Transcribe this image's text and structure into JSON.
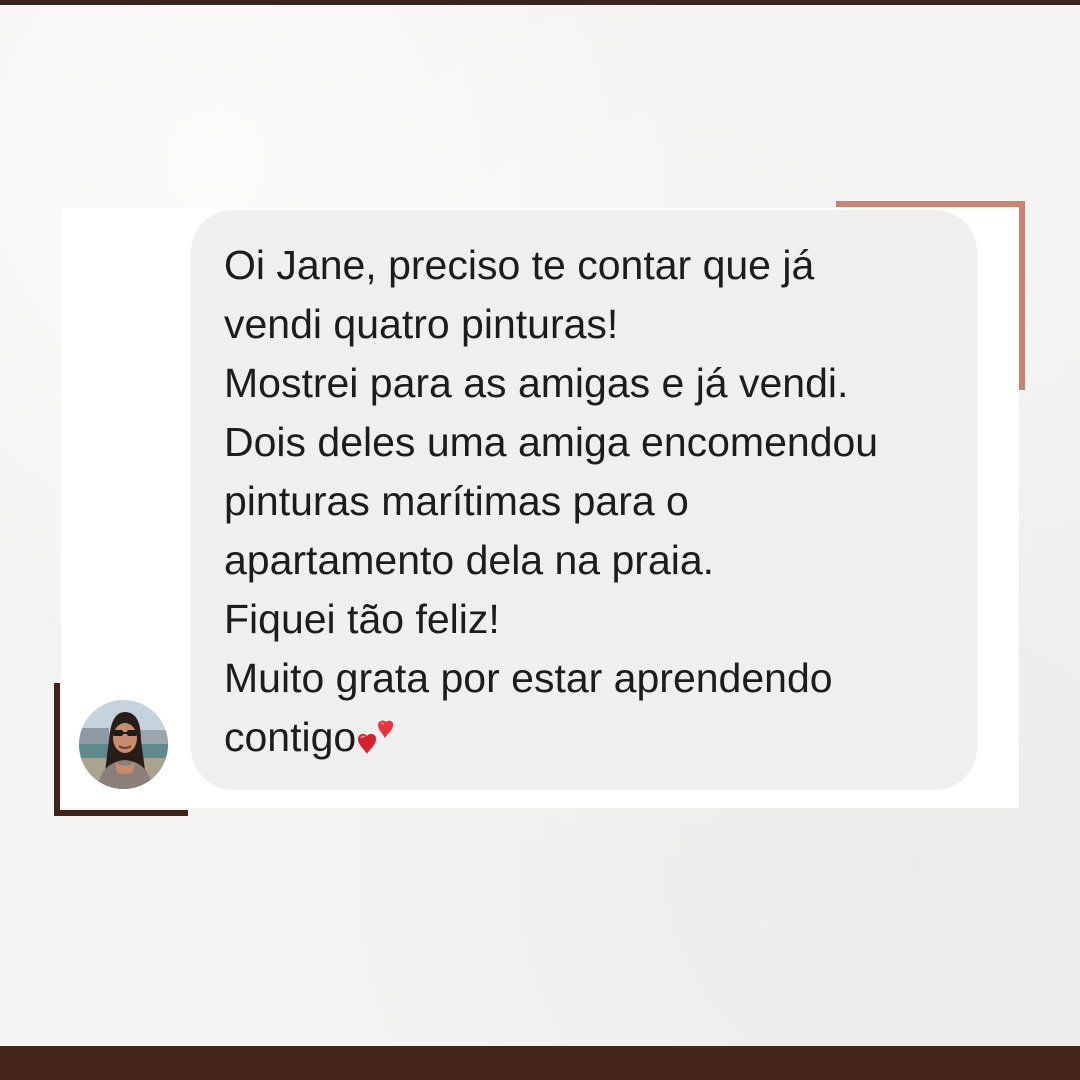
{
  "message": {
    "lines": [
      "Oi Jane, preciso te contar que já",
      "vendi quatro pinturas!",
      "Mostrei para as amigas e já vendi.",
      "Dois deles uma amiga encomendou",
      "pinturas marítimas para o",
      "apartamento dela na praia.",
      "Fiquei tão feliz!",
      "Muito grata por estar aprendendo",
      "contigo"
    ],
    "emoji": "heart-icon"
  },
  "sender": {
    "avatar": "avatar-photo"
  },
  "colors": {
    "top_bar": "#3b241b",
    "bottom_bar": "#45241a",
    "accent_top_right": "#c98372",
    "accent_bottom_left": "#40221a",
    "bubble": "#efefef",
    "card": "#ffffff"
  }
}
